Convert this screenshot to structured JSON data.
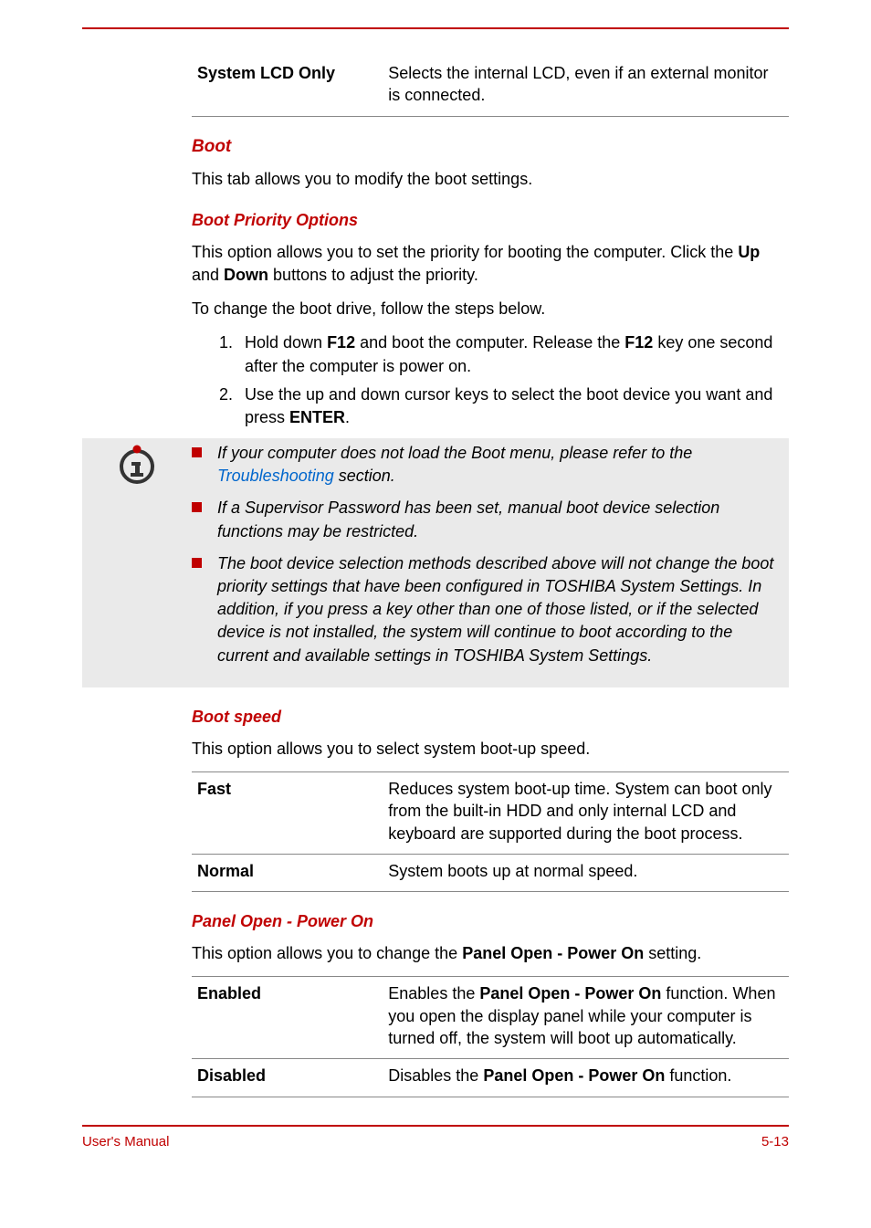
{
  "tables": {
    "lcd": {
      "rows": [
        {
          "label": "System LCD Only",
          "desc": "Selects the internal LCD, even if an external monitor is connected."
        }
      ]
    },
    "bootspeed": {
      "rows": [
        {
          "label": "Fast",
          "desc": "Reduces system boot-up time. System can boot only from the built-in HDD and only internal LCD and keyboard are supported during the boot process."
        },
        {
          "label": "Normal",
          "desc": "System boots up at normal speed."
        }
      ]
    },
    "panel": {
      "rows": [
        {
          "label": "Enabled",
          "desc_pre": "Enables the ",
          "desc_bold": "Panel Open - Power On",
          "desc_post": " function. When you open the display panel while your computer is turned off, the system will boot up automatically."
        },
        {
          "label": "Disabled",
          "desc_pre": "Disables the ",
          "desc_bold": "Panel Open - Power On",
          "desc_post": " function."
        }
      ]
    }
  },
  "boot": {
    "heading": "Boot",
    "intro": "This tab allows you to modify the boot settings."
  },
  "priority": {
    "heading": "Boot Priority Options",
    "p1_pre": "This option allows you to set the priority for booting the computer. Click the ",
    "p1_b1": "Up",
    "p1_mid": " and ",
    "p1_b2": "Down",
    "p1_post": " buttons to adjust the priority.",
    "p2": "To change the boot drive, follow the steps below.",
    "step1_pre": "Hold down ",
    "step1_b1": "F12",
    "step1_mid": " and boot the computer. Release the ",
    "step1_b2": "F12",
    "step1_post": " key one second after the computer is power on.",
    "step2_pre": "Use the up and down cursor keys to select the boot device you want and press ",
    "step2_b": "ENTER",
    "step2_post": "."
  },
  "notes": {
    "n1_pre": "If your computer does not load the Boot menu, please refer to the ",
    "n1_link": "Troubleshooting",
    "n1_post": " section.",
    "n2": "If a Supervisor Password has been set, manual boot device selection functions may be restricted.",
    "n3": "The boot device selection methods described above will not change the boot priority settings that have been configured in TOSHIBA System Settings. In addition, if you press a key other than one of those listed, or if the selected device is not installed, the system will continue to boot according to the current and available settings in TOSHIBA System Settings."
  },
  "speed": {
    "heading": "Boot speed",
    "intro": "This option allows you to select system boot-up speed."
  },
  "panelopen": {
    "heading": "Panel Open - Power On",
    "intro_pre": "This option allows you to change the ",
    "intro_bold": "Panel Open - Power On",
    "intro_post": " setting."
  },
  "footer": {
    "left": "User's Manual",
    "right": "5-13"
  }
}
